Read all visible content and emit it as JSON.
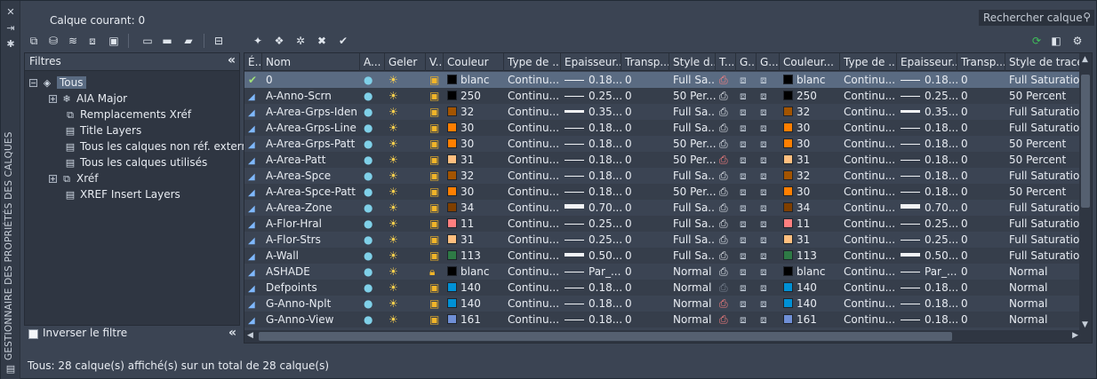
{
  "palette_title": "GESTIONNAIRE DES PROPRIÉTÉS DES CALQUES",
  "current_layer_label": "Calque courant: 0",
  "search": {
    "placeholder": "Rechercher calque",
    "icon": "search-icon"
  },
  "filters": {
    "heading": "Filtres",
    "collapse_icon": "double-chevron-left-icon",
    "tree": [
      {
        "label": "Tous",
        "expander": "−",
        "icon": "layers-icon",
        "selected": true
      },
      {
        "label": "AIA Major",
        "expander": "+",
        "icon": "snowflake-group-icon"
      },
      {
        "label": "Remplacements Xréf",
        "icon": "xref-override-icon"
      },
      {
        "label": "Title Layers",
        "icon": "property-filter-icon"
      },
      {
        "label": "Tous les calques non réf. externes",
        "icon": "property-filter-icon"
      },
      {
        "label": "Tous les calques utilisés",
        "icon": "property-filter-icon"
      },
      {
        "label": "Xréf",
        "expander": "+",
        "icon": "xref-icon"
      },
      {
        "label": "XREF Insert Layers",
        "icon": "property-filter-icon"
      }
    ],
    "invert_label": "Inverser le filtre",
    "invert_checked": false
  },
  "columns": [
    "É...",
    "Nom",
    "A...",
    "Geler",
    "V...",
    "Couleur",
    "Type de ...",
    "Epaisseur...",
    "Transp...",
    "Style d...",
    "T...",
    "G...",
    "G...",
    "Couleur...",
    "Type de ...",
    "Epaisseur...",
    "Transp...",
    "Style de tracé d"
  ],
  "layers": [
    {
      "name": "0",
      "status": "current",
      "color": "blanc",
      "color_hex": "#000000",
      "linetype": "Continu...",
      "lineweight": "0.18...",
      "lw_weight": 1,
      "transp": "0",
      "plotstyle": "Full Sa...",
      "vp_color": "blanc",
      "vp_color_hex": "#000000",
      "vp_linetype": "Continu...",
      "vp_lineweight": "0.18...",
      "vp_lw_weight": 1,
      "vp_transp": "0",
      "vp_plotstyle": "Full Saturation",
      "lock_closed": false,
      "noplot": true,
      "newvp_alt": true
    },
    {
      "name": "A-Anno-Scrn",
      "color": "250",
      "color_hex": "#000000",
      "linetype": "Continu...",
      "lineweight": "0.25...",
      "lw_weight": 1,
      "transp": "0",
      "plotstyle": "50 Per...",
      "vp_color": "250",
      "vp_color_hex": "#000000",
      "vp_linetype": "Continu...",
      "vp_lineweight": "0.25...",
      "vp_lw_weight": 1,
      "vp_transp": "0",
      "vp_plotstyle": "50 Percent"
    },
    {
      "name": "A-Area-Grps-Iden",
      "color": "32",
      "color_hex": "#a35400",
      "linetype": "Continu...",
      "lineweight": "0.35...",
      "lw_weight": 3,
      "transp": "0",
      "plotstyle": "Full Sa...",
      "vp_color": "32",
      "vp_color_hex": "#a35400",
      "vp_linetype": "Continu...",
      "vp_lineweight": "0.35...",
      "vp_lw_weight": 3,
      "vp_transp": "0",
      "vp_plotstyle": "Full Saturation"
    },
    {
      "name": "A-Area-Grps-Line",
      "color": "30",
      "color_hex": "#ff7f00",
      "linetype": "Continu...",
      "lineweight": "0.18...",
      "lw_weight": 1,
      "transp": "0",
      "plotstyle": "Full Sa...",
      "vp_color": "30",
      "vp_color_hex": "#ff7f00",
      "vp_linetype": "Continu...",
      "vp_lineweight": "0.18...",
      "vp_lw_weight": 1,
      "vp_transp": "0",
      "vp_plotstyle": "Full Saturation"
    },
    {
      "name": "A-Area-Grps-Patt",
      "color": "30",
      "color_hex": "#ff7f00",
      "linetype": "Continu...",
      "lineweight": "0.18...",
      "lw_weight": 1,
      "transp": "0",
      "plotstyle": "50 Per...",
      "vp_color": "30",
      "vp_color_hex": "#ff7f00",
      "vp_linetype": "Continu...",
      "vp_lineweight": "0.18...",
      "vp_lw_weight": 1,
      "vp_transp": "0",
      "vp_plotstyle": "50 Percent"
    },
    {
      "name": "A-Area-Patt",
      "color": "31",
      "color_hex": "#ffbf7f",
      "linetype": "Continu...",
      "lineweight": "0.18...",
      "lw_weight": 1,
      "transp": "0",
      "plotstyle": "50 Per...",
      "vp_color": "31",
      "vp_color_hex": "#ffbf7f",
      "vp_linetype": "Continu...",
      "vp_lineweight": "0.18...",
      "vp_lw_weight": 1,
      "vp_transp": "0",
      "vp_plotstyle": "50 Percent",
      "noplot": true
    },
    {
      "name": "A-Area-Spce",
      "color": "32",
      "color_hex": "#a35400",
      "linetype": "Continu...",
      "lineweight": "0.18...",
      "lw_weight": 1,
      "transp": "0",
      "plotstyle": "Full Sa...",
      "vp_color": "32",
      "vp_color_hex": "#a35400",
      "vp_linetype": "Continu...",
      "vp_lineweight": "0.18...",
      "vp_lw_weight": 1,
      "vp_transp": "0",
      "vp_plotstyle": "Full Saturation"
    },
    {
      "name": "A-Area-Spce-Patt",
      "color": "30",
      "color_hex": "#ff7f00",
      "linetype": "Continu...",
      "lineweight": "0.18...",
      "lw_weight": 1,
      "transp": "0",
      "plotstyle": "50 Per...",
      "vp_color": "30",
      "vp_color_hex": "#ff7f00",
      "vp_linetype": "Continu...",
      "vp_lineweight": "0.18...",
      "vp_lw_weight": 1,
      "vp_transp": "0",
      "vp_plotstyle": "50 Percent"
    },
    {
      "name": "A-Area-Zone",
      "color": "34",
      "color_hex": "#7f3f00",
      "linetype": "Continu...",
      "lineweight": "0.70...",
      "lw_weight": 5,
      "transp": "0",
      "plotstyle": "Full Sa...",
      "vp_color": "34",
      "vp_color_hex": "#7f3f00",
      "vp_linetype": "Continu...",
      "vp_lineweight": "0.70...",
      "vp_lw_weight": 5,
      "vp_transp": "0",
      "vp_plotstyle": "Full Saturation"
    },
    {
      "name": "A-Flor-Hral",
      "color": "11",
      "color_hex": "#ff7f7f",
      "linetype": "Continu...",
      "lineweight": "0.25...",
      "lw_weight": 1,
      "transp": "0",
      "plotstyle": "Full Sa...",
      "vp_color": "11",
      "vp_color_hex": "#ff7f7f",
      "vp_linetype": "Continu...",
      "vp_lineweight": "0.25...",
      "vp_lw_weight": 1,
      "vp_transp": "0",
      "vp_plotstyle": "Full Saturation"
    },
    {
      "name": "A-Flor-Strs",
      "color": "31",
      "color_hex": "#ffbf7f",
      "linetype": "Continu...",
      "lineweight": "0.25...",
      "lw_weight": 1,
      "transp": "0",
      "plotstyle": "Full Sa...",
      "vp_color": "31",
      "vp_color_hex": "#ffbf7f",
      "vp_linetype": "Continu...",
      "vp_lineweight": "0.25...",
      "vp_lw_weight": 1,
      "vp_transp": "0",
      "vp_plotstyle": "Full Saturation"
    },
    {
      "name": "A-Wall",
      "color": "113",
      "color_hex": "#2e7a45",
      "linetype": "Continu...",
      "lineweight": "0.50...",
      "lw_weight": 4,
      "transp": "0",
      "plotstyle": "Full Sa...",
      "vp_color": "113",
      "vp_color_hex": "#2e7a45",
      "vp_linetype": "Continu...",
      "vp_lineweight": "0.50...",
      "vp_lw_weight": 4,
      "vp_transp": "0",
      "vp_plotstyle": "Full Saturation"
    },
    {
      "name": "ASHADE",
      "color": "blanc",
      "color_hex": "#000000",
      "linetype": "Continu...",
      "lineweight": "Par_...",
      "lw_weight": 1,
      "transp": "0",
      "plotstyle": "Normal",
      "vp_color": "blanc",
      "vp_color_hex": "#000000",
      "vp_linetype": "Continu...",
      "vp_lineweight": "Par_...",
      "vp_lw_weight": 1,
      "vp_transp": "0",
      "vp_plotstyle": "Normal",
      "lock_closed": true
    },
    {
      "name": "Defpoints",
      "color": "140",
      "color_hex": "#0091d6",
      "linetype": "Continu...",
      "lineweight": "0.18...",
      "lw_weight": 1,
      "transp": "0",
      "plotstyle": "Normal",
      "vp_color": "140",
      "vp_color_hex": "#0091d6",
      "vp_linetype": "Continu...",
      "vp_lineweight": "0.18...",
      "vp_lw_weight": 1,
      "vp_transp": "0",
      "vp_plotstyle": "Normal",
      "plot_disabled": true
    },
    {
      "name": "G-Anno-Nplt",
      "color": "140",
      "color_hex": "#0091d6",
      "linetype": "Continu...",
      "lineweight": "0.18...",
      "lw_weight": 1,
      "transp": "0",
      "plotstyle": "Normal",
      "vp_color": "140",
      "vp_color_hex": "#0091d6",
      "vp_linetype": "Continu...",
      "vp_lineweight": "0.18...",
      "vp_lw_weight": 1,
      "vp_transp": "0",
      "vp_plotstyle": "Normal",
      "noplot": true,
      "newvp_alt": true
    },
    {
      "name": "G-Anno-View",
      "color": "161",
      "color_hex": "#6f8fd6",
      "linetype": "Continu...",
      "lineweight": "0.18...",
      "lw_weight": 1,
      "transp": "0",
      "plotstyle": "Normal",
      "vp_color": "161",
      "vp_color_hex": "#6f8fd6",
      "vp_linetype": "Continu...",
      "vp_lineweight": "0.18...",
      "vp_lw_weight": 1,
      "vp_transp": "0",
      "vp_plotstyle": "Normal",
      "noplot": true,
      "newvp_alt": true
    }
  ],
  "status_bar": "Tous: 28 calque(s) affiché(s) sur un total de 28 calque(s)"
}
